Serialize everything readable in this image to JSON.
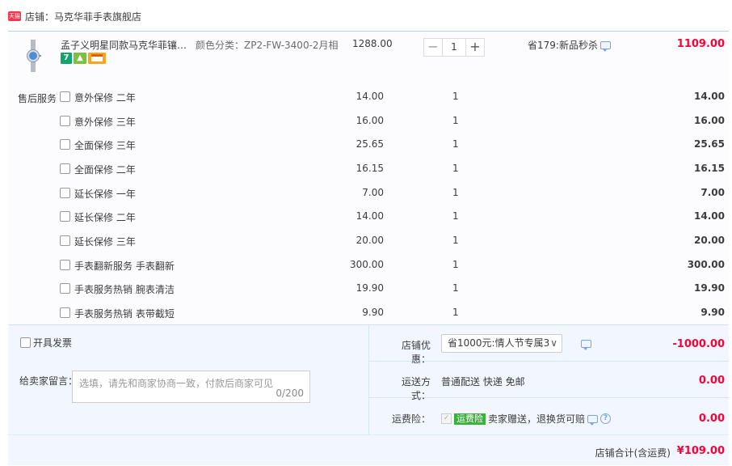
{
  "shop": {
    "badge": "天猫",
    "name": "店铺：马克华菲手表旗舰店"
  },
  "product": {
    "title": "孟子义明星同款马克华菲镶钻小...",
    "sku": "颜色分类：ZP2-FW-3400-2月相",
    "price": "1288.00",
    "quantity": "1",
    "promotion": "省179:新品秒杀",
    "total": "1109.00",
    "badges": [
      "7",
      "wood-icon",
      "card-icon"
    ]
  },
  "services": {
    "heading": "售后服务",
    "items": [
      {
        "label": "意外保修 二年",
        "price": "14.00",
        "qty": "1",
        "subtotal": "14.00"
      },
      {
        "label": "意外保修 三年",
        "price": "16.00",
        "qty": "1",
        "subtotal": "16.00"
      },
      {
        "label": "全面保修 三年",
        "price": "25.65",
        "qty": "1",
        "subtotal": "25.65"
      },
      {
        "label": "全面保修 二年",
        "price": "16.15",
        "qty": "1",
        "subtotal": "16.15"
      },
      {
        "label": "延长保修 一年",
        "price": "7.00",
        "qty": "1",
        "subtotal": "7.00"
      },
      {
        "label": "延长保修 二年",
        "price": "14.00",
        "qty": "1",
        "subtotal": "14.00"
      },
      {
        "label": "延长保修 三年",
        "price": "20.00",
        "qty": "1",
        "subtotal": "20.00"
      },
      {
        "label": "手表翻新服务 手表翻新",
        "price": "300.00",
        "qty": "1",
        "subtotal": "300.00"
      },
      {
        "label": "手表服务热销 腕表清洁",
        "price": "19.90",
        "qty": "1",
        "subtotal": "19.90"
      },
      {
        "label": "手表服务热销 表带截短",
        "price": "9.90",
        "qty": "1",
        "subtotal": "9.90"
      }
    ]
  },
  "invoice": {
    "label": "开具发票"
  },
  "message": {
    "label": "给卖家留言：",
    "placeholder": "选填，请先和商家协商一致，付款后商家可见",
    "count": "0/200"
  },
  "discount": {
    "label": "店铺优惠：",
    "selected": "省1000元:情人节专属3",
    "value": "-1000.00"
  },
  "shipping": {
    "label": "运送方式：",
    "method": "普通配送 快递 免邮",
    "value": "0.00"
  },
  "insurance": {
    "label": "运费险：",
    "tag": "运费险",
    "desc": "卖家赠送，退换货可赔",
    "value": "0.00"
  },
  "footer": {
    "label": "店铺合计(含运费)",
    "total": "¥109.00"
  },
  "colors": {
    "accent": "#ff0036",
    "border": "#b2d1ff",
    "panel": "#f2f7ff"
  }
}
